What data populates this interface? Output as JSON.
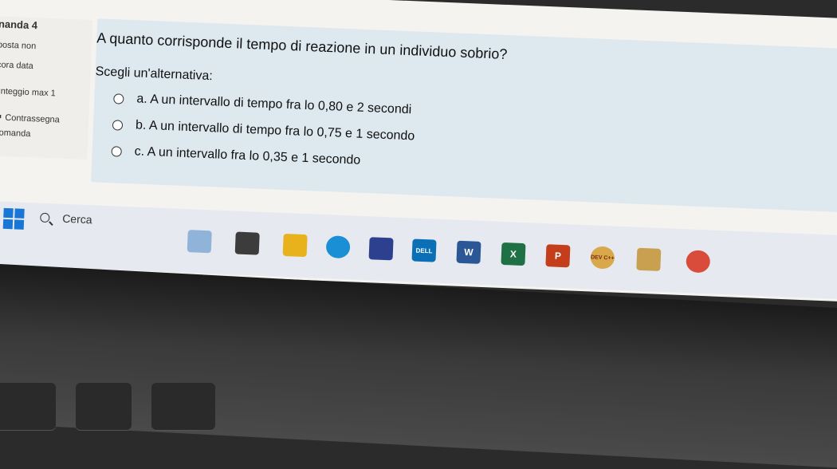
{
  "sidebar": {
    "question_label": "nanda 4",
    "status": "posta non",
    "answer_status": "cora data",
    "score": "unteggio max 1",
    "flag": "Contrassegna",
    "flag_cont": "domanda"
  },
  "question": {
    "text": "A quanto corrisponde il tempo di reazione in un individuo sobrio?",
    "prompt": "Scegli un'alternativa:",
    "options": [
      "a. A un intervallo di tempo fra lo 0,80 e 2 secondi",
      "b. A un intervallo di tempo fra lo 0,75 e 1 secondo",
      "c. A un intervallo fra lo 0,35 e 1 secondo"
    ]
  },
  "taskbar": {
    "search_label": "Cerca",
    "word_label": "W",
    "excel_label": "X",
    "ppt_label": "P",
    "dev_label": "DEV C++",
    "dell_label": "DELL"
  },
  "colors": {
    "question_bg": "#dde8ef",
    "windows_blue": "#1877d6",
    "word_blue": "#2b5797",
    "excel_green": "#1e7145",
    "ppt_red": "#c43e1c"
  }
}
